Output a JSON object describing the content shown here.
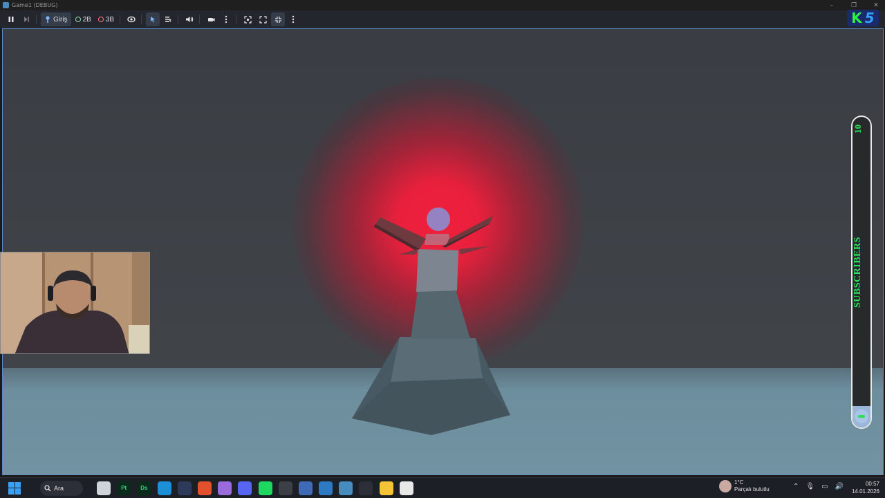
{
  "window": {
    "title": "Game1 (DEBUG)"
  },
  "toolbar": {
    "input_label": "Giriş",
    "mode_2d_label": "2B",
    "mode_3d_label": "3B"
  },
  "overlay": {
    "logo_letter": "K",
    "logo_number": "5",
    "subscriber_count": "10",
    "subscriber_label": "SUBSCRIBERS",
    "subscriber_progress": 0.07
  },
  "taskbar": {
    "search_label": "Ara",
    "weather_temp": "1°C",
    "weather_desc": "Parçalı bulutlu",
    "time": "00:57",
    "date": "14.01.2026",
    "apps": [
      {
        "icon": "file-explorer-icon",
        "text": "",
        "bg": "#cfd4da",
        "fg": "#333"
      },
      {
        "icon": "pt-app-icon",
        "text": "Pt",
        "bg": "#0b2b1a",
        "fg": "#31d98c"
      },
      {
        "icon": "ds-app-icon",
        "text": "Ds",
        "bg": "#0b2b1a",
        "fg": "#31d98c"
      },
      {
        "icon": "edge-icon",
        "text": "",
        "bg": "#1d8fd6",
        "fg": "#fff"
      },
      {
        "icon": "app-icon",
        "text": "",
        "bg": "#2d3a5a",
        "fg": "#fff"
      },
      {
        "icon": "brave-icon",
        "text": "",
        "bg": "#e2502c",
        "fg": "#fff"
      },
      {
        "icon": "chat-app-icon",
        "text": "",
        "bg": "#9a6bdc",
        "fg": "#fff"
      },
      {
        "icon": "discord-icon",
        "text": "",
        "bg": "#5865f2",
        "fg": "#fff"
      },
      {
        "icon": "spotify-icon",
        "text": "",
        "bg": "#1ed760",
        "fg": "#000"
      },
      {
        "icon": "app-icon",
        "text": "",
        "bg": "#3c3f46",
        "fg": "#fff"
      },
      {
        "icon": "app-icon",
        "text": "",
        "bg": "#3f6ab8",
        "fg": "#fff"
      },
      {
        "icon": "app-icon",
        "text": "",
        "bg": "#2e7ac2",
        "fg": "#fff"
      },
      {
        "icon": "godot-icon",
        "text": "",
        "bg": "#478cbf",
        "fg": "#fff"
      },
      {
        "icon": "chatgpt-icon",
        "text": "",
        "bg": "#2c2f37",
        "fg": "#fff"
      },
      {
        "icon": "folder-icon",
        "text": "",
        "bg": "#f4c436",
        "fg": "#fff"
      },
      {
        "icon": "app-icon",
        "text": "",
        "bg": "#e8e8e8",
        "fg": "#111"
      }
    ]
  }
}
